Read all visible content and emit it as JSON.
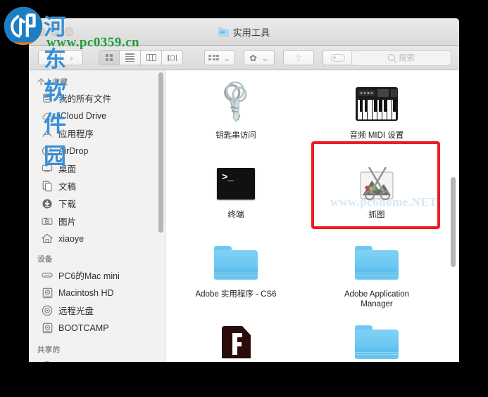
{
  "window": {
    "title": "实用工具",
    "title_icon": "utilities-folder-icon"
  },
  "toolbar": {
    "back_label": "‹",
    "forward_label": "›",
    "view_modes": [
      {
        "name": "icon-view",
        "label": "图标显示方式",
        "selected": true
      },
      {
        "name": "list-view",
        "label": "列表显示方式",
        "selected": false
      },
      {
        "name": "column-view",
        "label": "分栏显示方式",
        "selected": false
      },
      {
        "name": "coverflow-view",
        "label": "Cover Flow 显示方式",
        "selected": false
      }
    ],
    "arrange_label": "排列方式",
    "action_label": "操作",
    "share_label": "共享",
    "tag_label": "标记",
    "chevron": "⌄"
  },
  "search": {
    "placeholder": "搜索",
    "value": ""
  },
  "sidebar": {
    "sections": [
      {
        "header": "个人收藏",
        "items": [
          {
            "label": "我的所有文件",
            "icon": "all-my-files-icon"
          },
          {
            "label": "iCloud Drive",
            "icon": "icloud-drive-icon"
          },
          {
            "label": "应用程序",
            "icon": "applications-icon"
          },
          {
            "label": "AirDrop",
            "icon": "airdrop-icon"
          },
          {
            "label": "桌面",
            "icon": "desktop-icon"
          },
          {
            "label": "文稿",
            "icon": "documents-icon"
          },
          {
            "label": "下载",
            "icon": "downloads-icon"
          },
          {
            "label": "图片",
            "icon": "pictures-icon"
          },
          {
            "label": "xiaoye",
            "icon": "home-icon"
          }
        ]
      },
      {
        "header": "设备",
        "items": [
          {
            "label": "PC6的Mac mini",
            "icon": "mac-mini-icon"
          },
          {
            "label": "Macintosh HD",
            "icon": "hard-disk-icon"
          },
          {
            "label": "远程光盘",
            "icon": "remote-disc-icon"
          },
          {
            "label": "BOOTCAMP",
            "icon": "hard-disk-icon"
          }
        ]
      },
      {
        "header": "共享的",
        "items": []
      }
    ]
  },
  "content": {
    "items": [
      {
        "label": "钥匙串访问",
        "icon": "keychain-access-icon"
      },
      {
        "label": "音频 MIDI 设置",
        "icon": "audio-midi-setup-icon"
      },
      {
        "label": "终端",
        "icon": "terminal-icon"
      },
      {
        "label": "抓图",
        "icon": "grab-icon"
      },
      {
        "label": "Adobe 实用程序 - CS6",
        "icon": "folder-icon"
      },
      {
        "label": "Adobe Application Manager",
        "icon": "folder-icon"
      },
      {
        "label": "",
        "icon": "flash-player-icon"
      },
      {
        "label": "",
        "icon": "folder-icon"
      }
    ],
    "terminal_prompt": ">_",
    "inner_watermark": "www.pc6home.NET",
    "highlight_color": "#ec1c24"
  },
  "watermark": {
    "brand_cn": "河东软件园",
    "url": "www.pc0359.cn"
  }
}
